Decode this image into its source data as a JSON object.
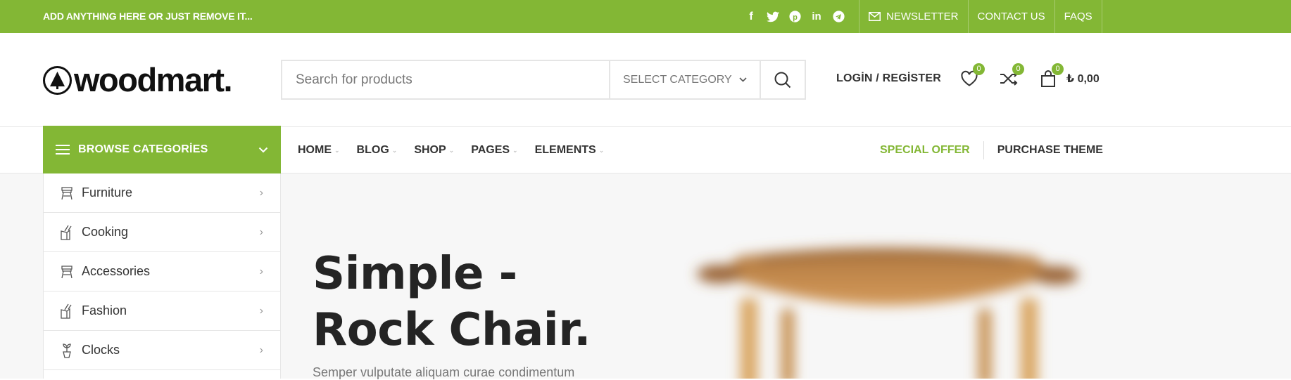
{
  "topbar": {
    "promo": "ADD ANYTHING HERE OR JUST REMOVE IT...",
    "social_icons": [
      "facebook-icon",
      "twitter-icon",
      "pinterest-icon",
      "linkedin-icon",
      "telegram-icon"
    ],
    "links": {
      "newsletter": "NEWSLETTER",
      "contact": "CONTACT US",
      "faqs": "FAQS"
    }
  },
  "header": {
    "logo_text": "woodmart.",
    "search": {
      "placeholder": "Search for products",
      "category": "SELECT CATEGORY"
    },
    "login": "LOGİN / REGİSTER",
    "wishlist_count": "0",
    "compare_count": "0",
    "cart_count": "0",
    "cart_total": "₺ 0,00"
  },
  "nav": {
    "browse": "BROWSE CATEGORİES",
    "items": [
      "HOME",
      "BLOG",
      "SHOP",
      "PAGES",
      "ELEMENTS"
    ],
    "special": "SPECIAL OFFER",
    "purchase": "PURCHASE THEME"
  },
  "categories": [
    "Furniture",
    "Cooking",
    "Accessories",
    "Fashion",
    "Clocks"
  ],
  "hero": {
    "title_line1": "Simple -",
    "title_line2": "Rock Chair.",
    "subtitle": "Semper vulputate aliquam curae condimentum"
  },
  "colors": {
    "accent": "#83b735",
    "dark": "#242424"
  }
}
